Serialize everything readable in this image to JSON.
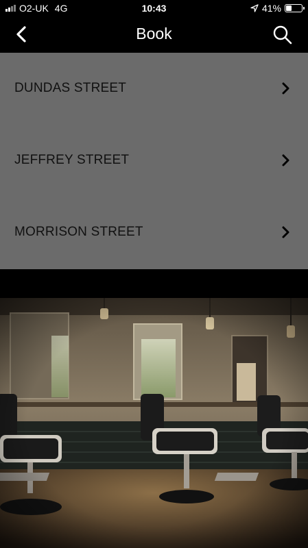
{
  "status": {
    "carrier": "O2-UK",
    "network": "4G",
    "time": "10:43",
    "battery": "41%",
    "battery_level": 0.41
  },
  "header": {
    "title": "Book",
    "back_icon": "chevron-left-icon",
    "search_icon": "search-icon"
  },
  "locations": [
    {
      "label": "DUNDAS STREET"
    },
    {
      "label": "JEFFREY STREET"
    },
    {
      "label": "MORRISON STREET"
    }
  ],
  "photo": {
    "subject": "barbershop-interior-image"
  }
}
